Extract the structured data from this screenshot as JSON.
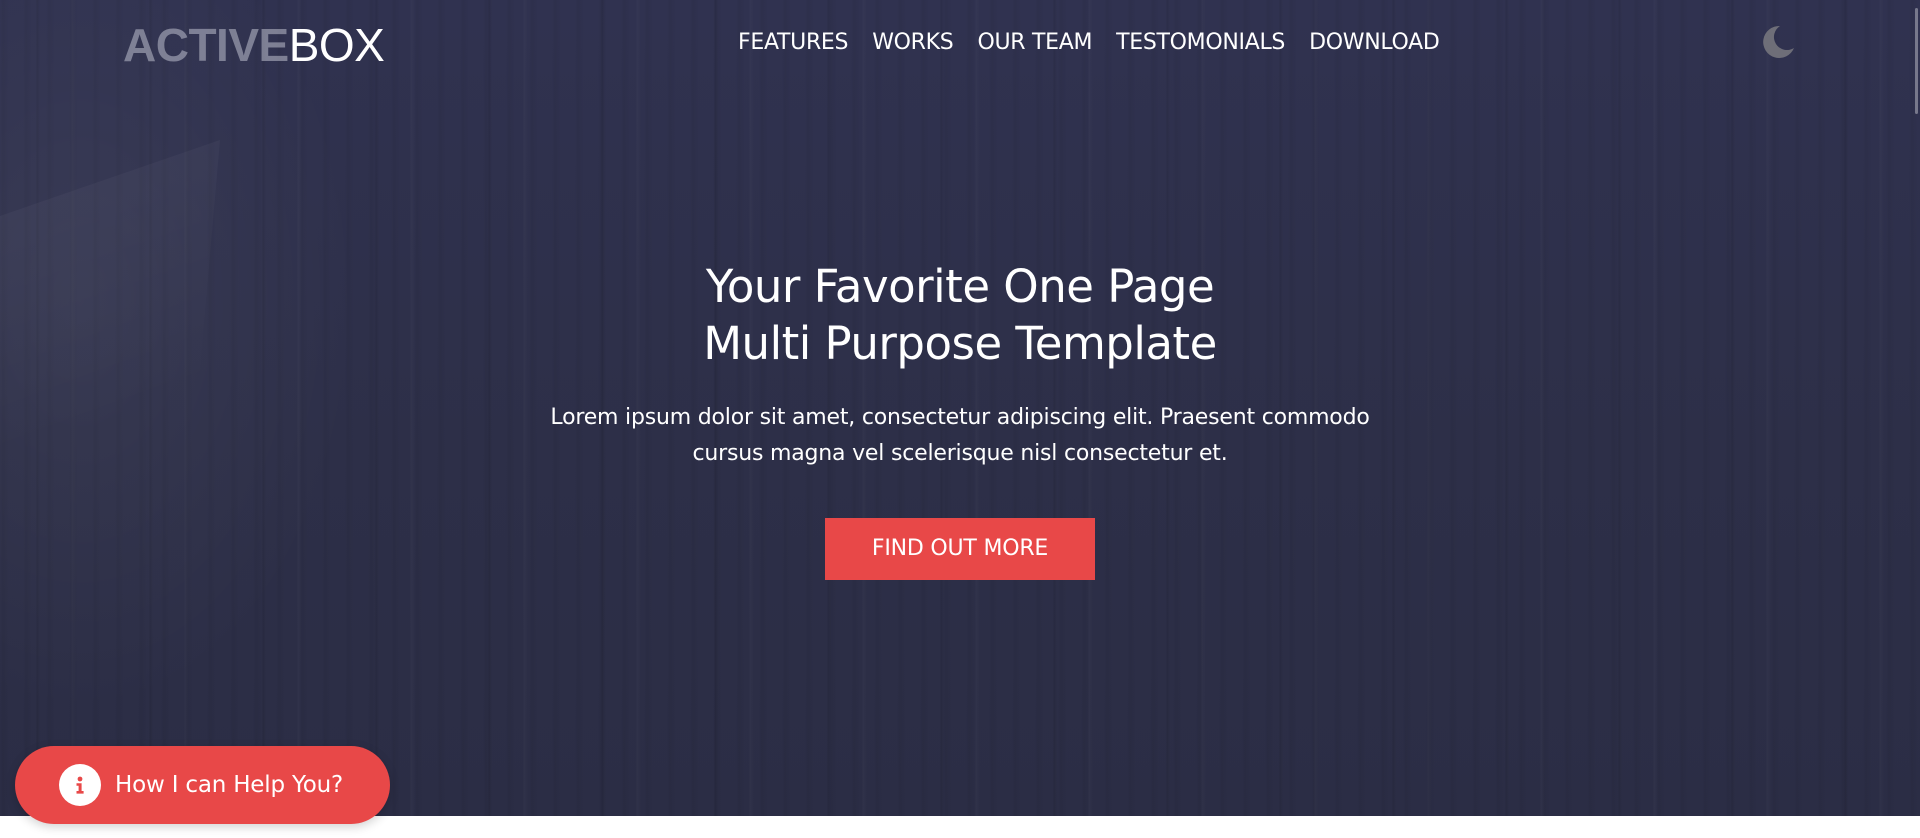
{
  "header": {
    "logo": {
      "strong": "ACTIVE",
      "light": "BOX"
    },
    "nav": [
      {
        "label": "FEATURES"
      },
      {
        "label": "WORKS"
      },
      {
        "label": "OUR TEAM"
      },
      {
        "label": "TESTOMONIALS"
      },
      {
        "label": "DOWNLOAD"
      }
    ],
    "theme_toggle_icon": "moon-icon"
  },
  "hero": {
    "title_line1": "Your Favorite One Page",
    "title_line2": "Multi Purpose Template",
    "subtitle_line1": "Lorem ipsum dolor sit amet, consectetur adipiscing elit. Praesent commodo",
    "subtitle_line2": "cursus magna vel scelerisque nisl consectetur et.",
    "cta_label": "FIND OUT MORE"
  },
  "help_widget": {
    "label": "How I can Help You?",
    "icon": "info-icon"
  },
  "colors": {
    "hero_background": "#2e3049",
    "accent": "#e84848",
    "text": "#ffffff",
    "moon": "#6e6e78"
  }
}
